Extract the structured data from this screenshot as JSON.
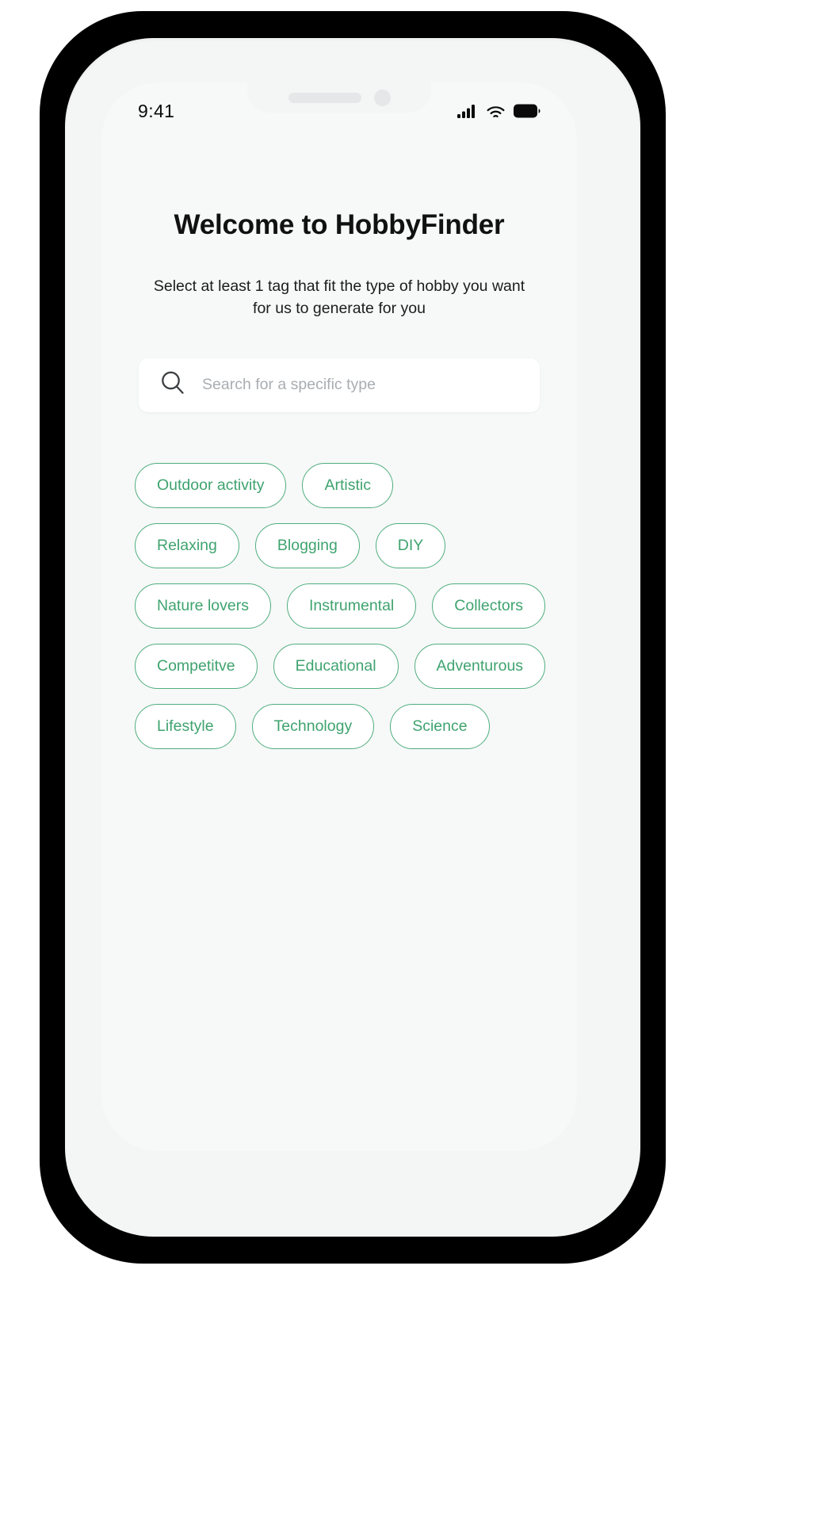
{
  "status_bar": {
    "time": "9:41",
    "icons": [
      "cellular-signal-icon",
      "wifi-icon",
      "battery-icon"
    ]
  },
  "header": {
    "title": "Welcome to HobbyFinder",
    "subtitle": "Select at least 1 tag that fit the type of hobby you want for us to generate for you"
  },
  "search": {
    "icon": "search-icon",
    "placeholder": "Search for a specific type",
    "value": ""
  },
  "tags": {
    "rows": [
      [
        {
          "label": "Outdoor activity",
          "selected": false
        },
        {
          "label": "Artistic",
          "selected": false
        }
      ],
      [
        {
          "label": "Relaxing",
          "selected": false
        },
        {
          "label": "Blogging",
          "selected": false
        },
        {
          "label": "DIY",
          "selected": false
        }
      ],
      [
        {
          "label": "Nature lovers",
          "selected": false
        },
        {
          "label": "Instrumental",
          "selected": false
        },
        {
          "label": "Collectors",
          "selected": false
        }
      ],
      [
        {
          "label": "Competitve",
          "selected": false
        },
        {
          "label": "Educational",
          "selected": false
        },
        {
          "label": "Adventurous",
          "selected": false
        }
      ],
      [
        {
          "label": "Lifestyle",
          "selected": false
        },
        {
          "label": "Technology",
          "selected": false
        },
        {
          "label": "Science",
          "selected": false
        }
      ]
    ]
  },
  "colors": {
    "accent_green": "#3fa36f",
    "chip_border": "#4fae7e",
    "screen_background": "#f7f8f8",
    "text_primary": "#111111",
    "placeholder": "#a9adb1"
  }
}
